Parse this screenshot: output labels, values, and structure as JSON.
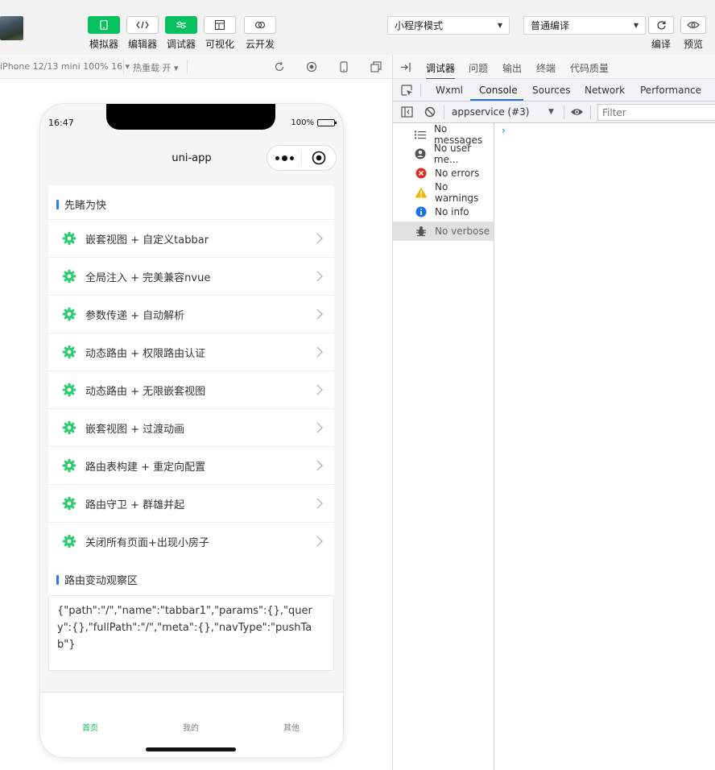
{
  "toolbar": {
    "buttons": [
      {
        "label": "模拟器",
        "icon": "phone-icon"
      },
      {
        "label": "编辑器",
        "icon": "code-icon"
      },
      {
        "label": "调试器",
        "icon": "debug-icon"
      },
      {
        "label": "可视化",
        "icon": "layout-icon"
      },
      {
        "label": "云开发",
        "icon": "cloud-icon"
      }
    ],
    "mode_select": "小程序模式",
    "compile_select": "普通编译",
    "compile_label": "编译",
    "preview_label": "预览"
  },
  "sim_bar": {
    "device": "iPhone 12/13 mini 100% 16 ▾",
    "hot_reload": "热重载 开 ▾"
  },
  "phone": {
    "time": "16:47",
    "battery": "100%",
    "nav_title": "uni-app",
    "section1_title": "先睹为快",
    "items": [
      "嵌套视图 + 自定义tabbar",
      "全局注入 + 完美兼容nvue",
      "参数传递 + 自动解析",
      "动态路由 + 权限路由认证",
      "动态路由 + 无限嵌套视图",
      "嵌套视图 + 过渡动画",
      "路由表构建 + 重定向配置",
      "路由守卫 + 群雄并起",
      "关闭所有页面+出现小房子"
    ],
    "section2_title": "路由变动观察区",
    "route_json": "{\"path\":\"/\",\"name\":\"tabbar1\",\"params\":{},\"query\":{},\"fullPath\":\"/\",\"meta\":{},\"navType\":\"pushTab\"}",
    "tabs": [
      "首页",
      "我的",
      "其他"
    ],
    "accent": "#07c160",
    "section_bar_color": "#2979ff"
  },
  "devtools": {
    "top_tabs": [
      "调试器",
      "问题",
      "输出",
      "终端",
      "代码质量"
    ],
    "tabs": [
      "Wxml",
      "Console",
      "Sources",
      "Network",
      "Performance"
    ],
    "context": "appservice (#3)",
    "filter_placeholder": "Filter",
    "levels": [
      {
        "label": "No messages",
        "icon": "list-icon"
      },
      {
        "label": "No user me...",
        "icon": "user-icon"
      },
      {
        "label": "No errors",
        "icon": "error-icon"
      },
      {
        "label": "No warnings",
        "icon": "warning-icon"
      },
      {
        "label": "No info",
        "icon": "info-icon"
      },
      {
        "label": "No verbose",
        "icon": "bug-icon"
      }
    ],
    "prompt": "›"
  }
}
